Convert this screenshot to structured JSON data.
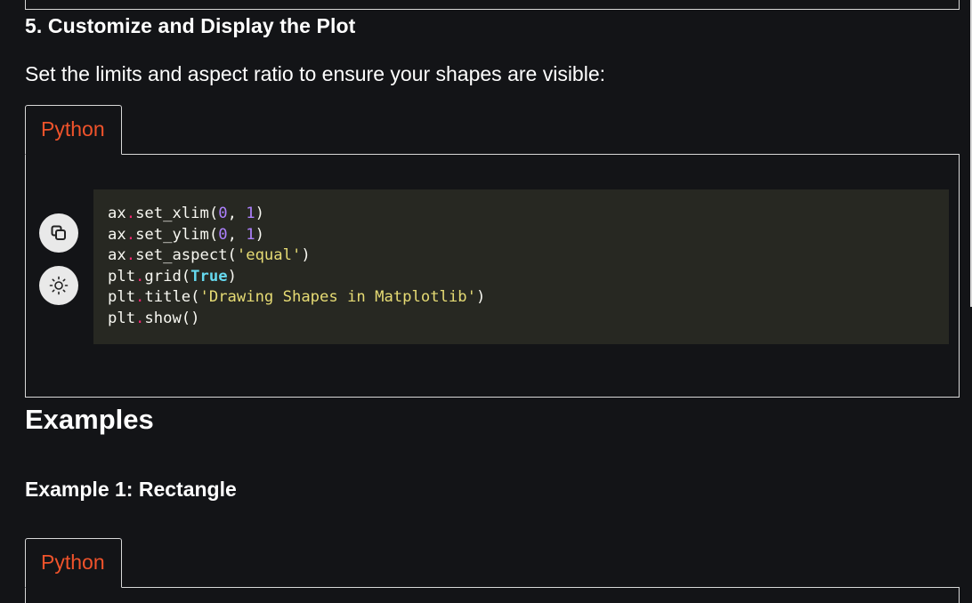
{
  "section": {
    "heading": "5. Customize and Display the Plot",
    "paragraph": "Set the limits and aspect ratio to ensure your shapes are visible:"
  },
  "code_block_1": {
    "language_tab": "Python",
    "lines": [
      [
        {
          "t": "ax"
        },
        {
          "t": ".",
          "c": "op"
        },
        {
          "t": "set_xlim("
        },
        {
          "t": "0",
          "c": "num"
        },
        {
          "t": ", "
        },
        {
          "t": "1",
          "c": "num"
        },
        {
          "t": ")"
        }
      ],
      [
        {
          "t": "ax"
        },
        {
          "t": ".",
          "c": "op"
        },
        {
          "t": "set_ylim("
        },
        {
          "t": "0",
          "c": "num"
        },
        {
          "t": ", "
        },
        {
          "t": "1",
          "c": "num"
        },
        {
          "t": ")"
        }
      ],
      [
        {
          "t": "ax"
        },
        {
          "t": ".",
          "c": "op"
        },
        {
          "t": "set_aspect("
        },
        {
          "t": "'equal'",
          "c": "str"
        },
        {
          "t": ")"
        }
      ],
      [
        {
          "t": "plt"
        },
        {
          "t": ".",
          "c": "op"
        },
        {
          "t": "grid("
        },
        {
          "t": "True",
          "c": "kw"
        },
        {
          "t": ")"
        }
      ],
      [
        {
          "t": "plt"
        },
        {
          "t": ".",
          "c": "op"
        },
        {
          "t": "title("
        },
        {
          "t": "'Drawing Shapes in Matplotlib'",
          "c": "str"
        },
        {
          "t": ")"
        }
      ],
      [
        {
          "t": "plt"
        },
        {
          "t": ".",
          "c": "op"
        },
        {
          "t": "show()"
        }
      ]
    ],
    "copy_icon": "copy-icon",
    "theme_icon": "sun-icon"
  },
  "examples": {
    "heading": "Examples",
    "example1_heading": "Example 1: Rectangle"
  },
  "code_block_2": {
    "language_tab": "Python"
  },
  "colors": {
    "background": "#131417",
    "code_background": "#272822",
    "tab_text": "#f0532b",
    "border": "#d8d8d8",
    "code_operator": "#f92672",
    "code_number": "#ae81ff",
    "code_string": "#e6db74",
    "code_keyword": "#66d9ef"
  }
}
